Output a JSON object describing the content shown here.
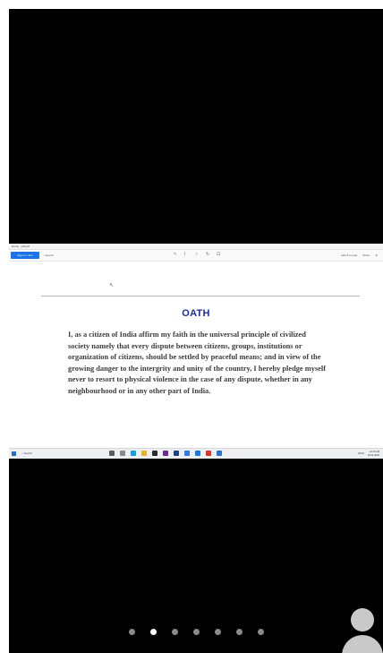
{
  "window": {
    "title": "Home · pdf.pdf"
  },
  "toolbar": {
    "signin_label": "Sign in / Join",
    "search_label": "Search",
    "tool_icons": [
      "cursor-icon",
      "text-select-icon",
      "zoom-icon",
      "rotate-icon",
      "fit-icon"
    ],
    "right_items": [
      "Edit & Create",
      "Share"
    ]
  },
  "document": {
    "title": "OATH",
    "body": "I, as a citizen of India affirm my faith in the universal principle of civilized society namely that every dispute between citizens, groups, institutions or organization of citizens, should be settled by peaceful means; and in view of the growing danger to the intergrity and unity of the country, I hereby pledge myself never to resort to physical violence in the case of any dispute, whether in any neighbourhood or in any other part of India."
  },
  "taskbar": {
    "search_label": "Search",
    "apps": [
      {
        "name": "file-explorer-icon",
        "color": "#5c5c5c"
      },
      {
        "name": "task-view-icon",
        "color": "#8a8a8a"
      },
      {
        "name": "edge-icon",
        "color": "#1a9de0"
      },
      {
        "name": "files-icon",
        "color": "#e6b422"
      },
      {
        "name": "store-icon",
        "color": "#2a2a2a"
      },
      {
        "name": "app-v-icon",
        "color": "#6a2c91"
      },
      {
        "name": "app-dark-icon",
        "color": "#1f3e8c"
      },
      {
        "name": "app-blue-icon",
        "color": "#2d7be5"
      },
      {
        "name": "app-mail-icon",
        "color": "#1979d8"
      },
      {
        "name": "app-red-icon",
        "color": "#d9352c"
      },
      {
        "name": "app-photos-icon",
        "color": "#2b6fd1"
      }
    ],
    "tray_text": "ENG",
    "time": "10:15 AM",
    "date": "28-11-2020"
  },
  "carousel": {
    "total": 7,
    "active_index": 1
  }
}
